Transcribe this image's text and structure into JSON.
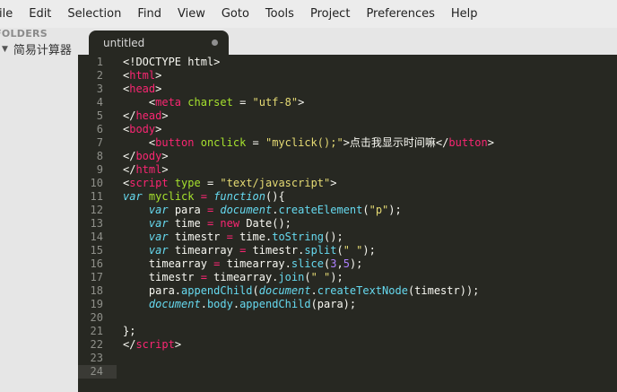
{
  "menu": {
    "items": [
      "ile",
      "Edit",
      "Selection",
      "Find",
      "View",
      "Goto",
      "Tools",
      "Project",
      "Preferences",
      "Help"
    ],
    "title_fragment": "( ⋯ ⋯ ⋯ ⋯ ⋯ ⋯ ⋯ )"
  },
  "sidebar": {
    "folders_label": "FOLDERS",
    "folder_name": "简易计算器"
  },
  "tab": {
    "label": "untitled"
  },
  "editor": {
    "lines": [
      {
        "n": "1",
        "tokens": [
          {
            "t": "<!DOCTYPE html>",
            "c": "plain"
          }
        ]
      },
      {
        "n": "2",
        "tokens": [
          {
            "t": "<",
            "c": "plain"
          },
          {
            "t": "html",
            "c": "tag"
          },
          {
            "t": ">",
            "c": "plain"
          }
        ]
      },
      {
        "n": "3",
        "tokens": [
          {
            "t": "<",
            "c": "plain"
          },
          {
            "t": "head",
            "c": "tag"
          },
          {
            "t": ">",
            "c": "plain"
          }
        ]
      },
      {
        "n": "4",
        "tokens": [
          {
            "t": "    <",
            "c": "plain"
          },
          {
            "t": "meta",
            "c": "tag"
          },
          {
            "t": " ",
            "c": "plain"
          },
          {
            "t": "charset",
            "c": "attr"
          },
          {
            "t": " = ",
            "c": "plain"
          },
          {
            "t": "\"utf-8\"",
            "c": "str"
          },
          {
            "t": ">",
            "c": "plain"
          }
        ]
      },
      {
        "n": "5",
        "tokens": [
          {
            "t": "</",
            "c": "plain"
          },
          {
            "t": "head",
            "c": "tag"
          },
          {
            "t": ">",
            "c": "plain"
          }
        ]
      },
      {
        "n": "6",
        "tokens": [
          {
            "t": "<",
            "c": "plain"
          },
          {
            "t": "body",
            "c": "tag"
          },
          {
            "t": ">",
            "c": "plain"
          }
        ]
      },
      {
        "n": "7",
        "tokens": [
          {
            "t": "    <",
            "c": "plain"
          },
          {
            "t": "button",
            "c": "tag"
          },
          {
            "t": " ",
            "c": "plain"
          },
          {
            "t": "onclick",
            "c": "attr"
          },
          {
            "t": " = ",
            "c": "plain"
          },
          {
            "t": "\"myclick();\"",
            "c": "str"
          },
          {
            "t": ">点击我显示时间嘛</",
            "c": "plain"
          },
          {
            "t": "button",
            "c": "tag"
          },
          {
            "t": ">",
            "c": "plain"
          }
        ]
      },
      {
        "n": "8",
        "tokens": [
          {
            "t": "</",
            "c": "plain"
          },
          {
            "t": "body",
            "c": "tag"
          },
          {
            "t": ">",
            "c": "plain"
          }
        ]
      },
      {
        "n": "9",
        "tokens": [
          {
            "t": "</",
            "c": "plain"
          },
          {
            "t": "html",
            "c": "tag"
          },
          {
            "t": ">",
            "c": "plain"
          }
        ]
      },
      {
        "n": "10",
        "tokens": [
          {
            "t": "<",
            "c": "plain"
          },
          {
            "t": "script",
            "c": "tag"
          },
          {
            "t": " ",
            "c": "plain"
          },
          {
            "t": "type",
            "c": "attr"
          },
          {
            "t": " = ",
            "c": "plain"
          },
          {
            "t": "\"text/javascript\"",
            "c": "str"
          },
          {
            "t": ">",
            "c": "plain"
          }
        ]
      },
      {
        "n": "11",
        "tokens": [
          {
            "t": "var",
            "c": "kw"
          },
          {
            "t": " ",
            "c": "plain"
          },
          {
            "t": "myclick",
            "c": "fn"
          },
          {
            "t": " ",
            "c": "plain"
          },
          {
            "t": "=",
            "c": "op"
          },
          {
            "t": " ",
            "c": "plain"
          },
          {
            "t": "function",
            "c": "kw"
          },
          {
            "t": "(){",
            "c": "plain"
          }
        ]
      },
      {
        "n": "12",
        "tokens": [
          {
            "t": "    ",
            "c": "plain"
          },
          {
            "t": "var",
            "c": "kw"
          },
          {
            "t": " para ",
            "c": "plain"
          },
          {
            "t": "=",
            "c": "op"
          },
          {
            "t": " ",
            "c": "plain"
          },
          {
            "t": "document",
            "c": "builtin"
          },
          {
            "t": ".",
            "c": "plain"
          },
          {
            "t": "createElement",
            "c": "method"
          },
          {
            "t": "(",
            "c": "plain"
          },
          {
            "t": "\"p\"",
            "c": "str"
          },
          {
            "t": ");",
            "c": "plain"
          }
        ]
      },
      {
        "n": "13",
        "tokens": [
          {
            "t": "    ",
            "c": "plain"
          },
          {
            "t": "var",
            "c": "kw"
          },
          {
            "t": " time ",
            "c": "plain"
          },
          {
            "t": "=",
            "c": "op"
          },
          {
            "t": " ",
            "c": "plain"
          },
          {
            "t": "new",
            "c": "op"
          },
          {
            "t": " Date();",
            "c": "plain"
          }
        ]
      },
      {
        "n": "14",
        "tokens": [
          {
            "t": "    ",
            "c": "plain"
          },
          {
            "t": "var",
            "c": "kw"
          },
          {
            "t": " timestr ",
            "c": "plain"
          },
          {
            "t": "=",
            "c": "op"
          },
          {
            "t": " time.",
            "c": "plain"
          },
          {
            "t": "toString",
            "c": "method"
          },
          {
            "t": "();",
            "c": "plain"
          }
        ]
      },
      {
        "n": "15",
        "tokens": [
          {
            "t": "    ",
            "c": "plain"
          },
          {
            "t": "var",
            "c": "kw"
          },
          {
            "t": " timearray ",
            "c": "plain"
          },
          {
            "t": "=",
            "c": "op"
          },
          {
            "t": " timestr.",
            "c": "plain"
          },
          {
            "t": "split",
            "c": "method"
          },
          {
            "t": "(",
            "c": "plain"
          },
          {
            "t": "\" \"",
            "c": "str"
          },
          {
            "t": ");",
            "c": "plain"
          }
        ]
      },
      {
        "n": "16",
        "tokens": [
          {
            "t": "    timearray ",
            "c": "plain"
          },
          {
            "t": "=",
            "c": "op"
          },
          {
            "t": " timearray.",
            "c": "plain"
          },
          {
            "t": "slice",
            "c": "method"
          },
          {
            "t": "(",
            "c": "plain"
          },
          {
            "t": "3",
            "c": "num"
          },
          {
            "t": ",",
            "c": "plain"
          },
          {
            "t": "5",
            "c": "num"
          },
          {
            "t": ");",
            "c": "plain"
          }
        ]
      },
      {
        "n": "17",
        "tokens": [
          {
            "t": "    timestr ",
            "c": "plain"
          },
          {
            "t": "=",
            "c": "op"
          },
          {
            "t": " timearray.",
            "c": "plain"
          },
          {
            "t": "join",
            "c": "method"
          },
          {
            "t": "(",
            "c": "plain"
          },
          {
            "t": "\" \"",
            "c": "str"
          },
          {
            "t": ");",
            "c": "plain"
          }
        ]
      },
      {
        "n": "18",
        "tokens": [
          {
            "t": "    para.",
            "c": "plain"
          },
          {
            "t": "appendChild",
            "c": "method"
          },
          {
            "t": "(",
            "c": "plain"
          },
          {
            "t": "document",
            "c": "builtin"
          },
          {
            "t": ".",
            "c": "plain"
          },
          {
            "t": "createTextNode",
            "c": "method"
          },
          {
            "t": "(timestr));",
            "c": "plain"
          }
        ]
      },
      {
        "n": "19",
        "tokens": [
          {
            "t": "    ",
            "c": "plain"
          },
          {
            "t": "document",
            "c": "builtin"
          },
          {
            "t": ".",
            "c": "plain"
          },
          {
            "t": "body",
            "c": "method"
          },
          {
            "t": ".",
            "c": "plain"
          },
          {
            "t": "appendChild",
            "c": "method"
          },
          {
            "t": "(para);",
            "c": "plain"
          }
        ]
      },
      {
        "n": "20",
        "tokens": []
      },
      {
        "n": "21",
        "tokens": [
          {
            "t": "};",
            "c": "plain"
          }
        ]
      },
      {
        "n": "22",
        "tokens": [
          {
            "t": "</",
            "c": "plain"
          },
          {
            "t": "script",
            "c": "tag"
          },
          {
            "t": ">",
            "c": "plain"
          }
        ]
      },
      {
        "n": "23",
        "tokens": []
      },
      {
        "n": "24",
        "tokens": [],
        "current": true
      }
    ]
  },
  "colors": {
    "editor_bg": "#272822",
    "tag": "#f92672",
    "attr": "#a6e22e",
    "string": "#e6db74",
    "keyword": "#66d9ef",
    "number": "#ae81ff"
  }
}
